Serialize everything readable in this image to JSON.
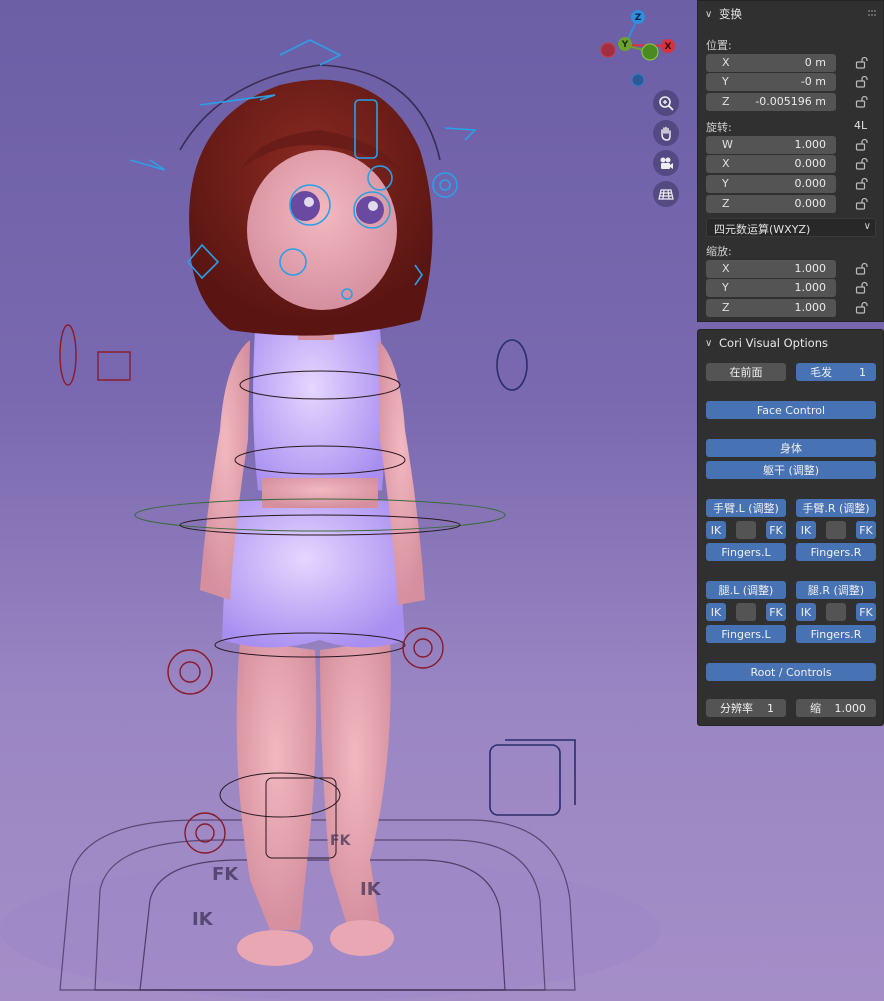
{
  "viewport": {
    "gizmo_axes": {
      "z": "Z",
      "y": "Y",
      "x": "X"
    },
    "gizmo_colors": {
      "z": "#2f8fdc",
      "y": "#6aa32d",
      "x": "#d9323f"
    },
    "scene_labels": [
      "FK",
      "IK",
      "FK",
      "IK"
    ],
    "nav_tools": [
      "zoom-icon",
      "hand-icon",
      "camera-icon",
      "grid-icon"
    ]
  },
  "transform": {
    "title": "变换",
    "location_label": "位置:",
    "location": [
      {
        "axis": "X",
        "value": "0 m"
      },
      {
        "axis": "Y",
        "value": "-0 m"
      },
      {
        "axis": "Z",
        "value": "-0.005196 m"
      }
    ],
    "rotation_label": "旋转:",
    "rotation_mode_short": "4L",
    "rotation": [
      {
        "axis": "W",
        "value": "1.000"
      },
      {
        "axis": "X",
        "value": "0.000"
      },
      {
        "axis": "Y",
        "value": "0.000"
      },
      {
        "axis": "Z",
        "value": "0.000"
      }
    ],
    "rotation_mode": "四元数运算(WXYZ)",
    "scale_label": "缩放:",
    "scale": [
      {
        "axis": "X",
        "value": "1.000"
      },
      {
        "axis": "Y",
        "value": "1.000"
      },
      {
        "axis": "Z",
        "value": "1.000"
      }
    ]
  },
  "cori": {
    "title": "Cori Visual Options",
    "in_front": "在前面",
    "hair_label": "毛发",
    "hair_value": "1",
    "face_control": "Face Control",
    "body": "身体",
    "torso": "躯干 (调整)",
    "arm_l": "手臂.L (调整)",
    "arm_r": "手臂.R (调整)",
    "ik": "IK",
    "fk": "FK",
    "fingers_l": "Fingers.L",
    "fingers_r": "Fingers.R",
    "leg_l": "腿.L (调整)",
    "leg_r": "腿.R (调整)",
    "root_controls": "Root / Controls",
    "resolution_label": "分辨率",
    "resolution_value": "1",
    "scale_label": "缩",
    "scale_value": "1.000"
  }
}
